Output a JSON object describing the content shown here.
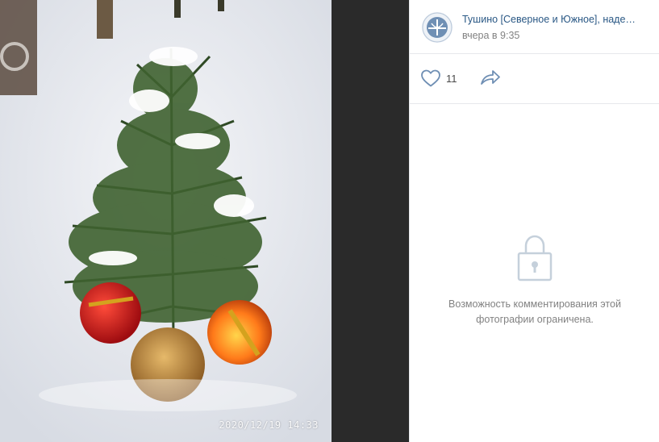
{
  "photo": {
    "date_stamp": "2020/12/19  14:33"
  },
  "post": {
    "group_name": "Тушино [Северное и Южное], наде…",
    "time": "вчера в 9:35",
    "likes_count": "11"
  },
  "comments": {
    "restricted_line1": "Возможность комментирования этой",
    "restricted_line2": "фотографии ограничена."
  },
  "colors": {
    "link": "#2a5885",
    "muted": "#828282",
    "icon": "#6f8fb4",
    "dark_bg": "#2a2a2a"
  },
  "icons": [
    "heart-icon",
    "share-arrow-icon",
    "lock-icon"
  ]
}
